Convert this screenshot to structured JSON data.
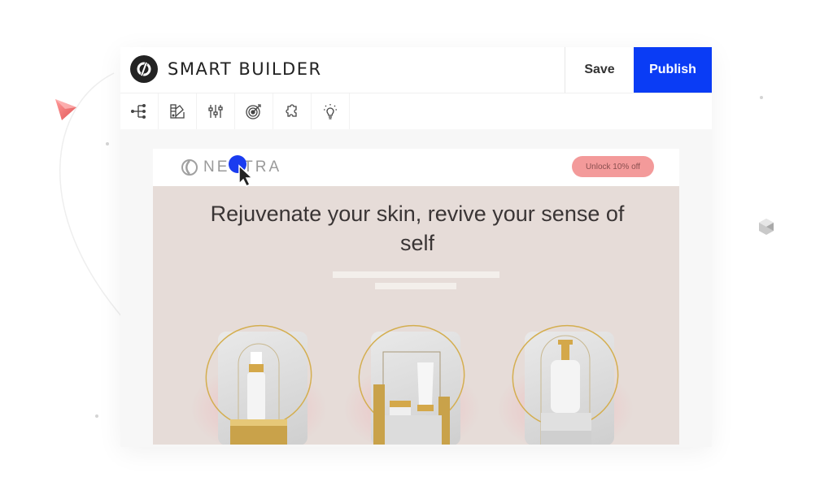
{
  "app": {
    "brand_name": "SMART BUILDER",
    "logo_icon": "unbounce-logo-icon"
  },
  "topbar": {
    "save_label": "Save",
    "publish_label": "Publish",
    "accent_color": "#0a3cf5"
  },
  "toolbar": {
    "tools": [
      {
        "name": "tree-icon",
        "label": "Page structure"
      },
      {
        "name": "palette-icon",
        "label": "Styles"
      },
      {
        "name": "sliders-icon",
        "label": "Settings"
      },
      {
        "name": "target-icon",
        "label": "Goals"
      },
      {
        "name": "puzzle-icon",
        "label": "Integrations"
      },
      {
        "name": "lightbulb-icon",
        "label": "Insights"
      }
    ]
  },
  "preview": {
    "brand_name": "NEUTRA",
    "cta_label": "Unlock 10% off",
    "cta_color": "#f39a9a",
    "headline": "Rejuvenate your skin, revive your sense of self",
    "background_color": "#e6dcd8",
    "products": [
      {
        "name": "serum-dropper-bottle"
      },
      {
        "name": "cream-tube-and-jar"
      },
      {
        "name": "pump-lotion-bottle"
      }
    ]
  }
}
